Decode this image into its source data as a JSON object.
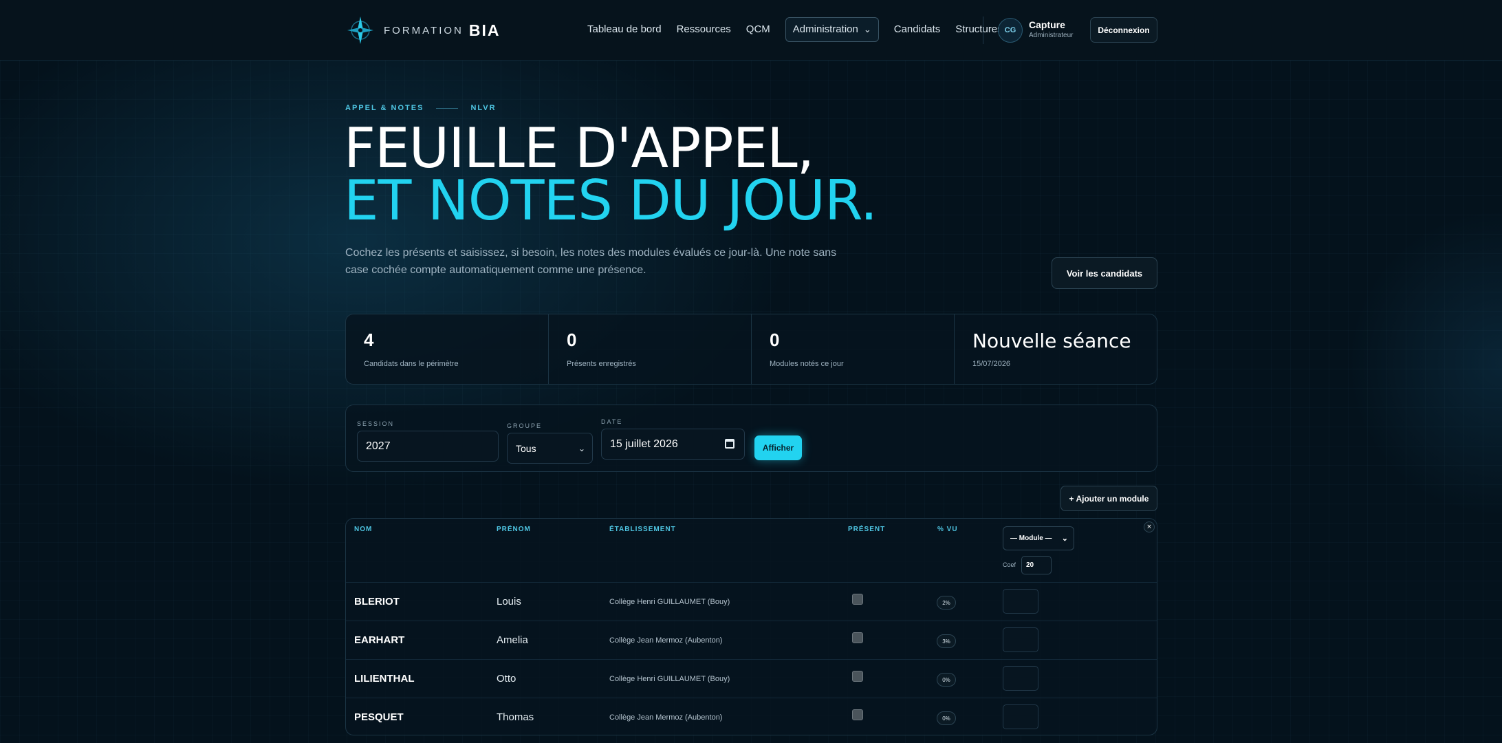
{
  "brand": {
    "small": "FORMATION",
    "big": "BIA"
  },
  "nav": {
    "items": [
      {
        "label": "Tableau de bord"
      },
      {
        "label": "Ressources"
      },
      {
        "label": "QCM"
      },
      {
        "label": "Administration"
      },
      {
        "label": "Candidats"
      },
      {
        "label": "Structures"
      }
    ],
    "user": {
      "initials": "CG",
      "name": "Capture",
      "role": "Administrateur"
    },
    "logout_label": "Déconnexion"
  },
  "hero": {
    "eyebrow_left": "APPEL & NOTES",
    "eyebrow_right": "NLVR",
    "title_line1": "FEUILLE D'APPEL,",
    "title_line2": "ET NOTES DU JOUR.",
    "lead": "Cochez les présents et saisissez, si besoin, les notes des modules évalués ce jour-là. Une note sans case cochée compte automatiquement comme une présence.",
    "candidates_button": "Voir les candidats"
  },
  "stats": [
    {
      "value": "4",
      "label": "Candidats dans le périmètre"
    },
    {
      "value": "0",
      "label": "Présents enregistrés"
    },
    {
      "value": "0",
      "label": "Modules notés ce jour"
    },
    {
      "value": "Nouvelle séance",
      "label": "15/07/2026"
    }
  ],
  "filters": {
    "session_label": "SESSION",
    "session_value": "2027",
    "groupe_label": "GROUPE",
    "groupe_value": "Tous",
    "date_label": "DATE",
    "date_value": "15 juillet 2026",
    "show_button": "Afficher"
  },
  "add_module_button": "+ Ajouter un module",
  "table": {
    "headers": {
      "nom": "NOM",
      "prenom": "PRÉNOM",
      "etablissement": "ÉTABLISSEMENT",
      "present": "PRÉSENT",
      "vu": "% VU"
    },
    "module_select": "— Module —",
    "close": "×",
    "coef_label": "Coef",
    "coef_value": "20",
    "rows": [
      {
        "nom": "BLERIOT",
        "prenom": "Louis",
        "etablissement": "Collège Henri GUILLAUMET (Bouy)",
        "vu": "2%"
      },
      {
        "nom": "EARHART",
        "prenom": "Amelia",
        "etablissement": "Collège Jean Mermoz (Aubenton)",
        "vu": "3%"
      },
      {
        "nom": "LILIENTHAL",
        "prenom": "Otto",
        "etablissement": "Collège Henri GUILLAUMET (Bouy)",
        "vu": "0%"
      },
      {
        "nom": "PESQUET",
        "prenom": "Thomas",
        "etablissement": "Collège Jean Mermoz (Aubenton)",
        "vu": "0%"
      }
    ]
  }
}
